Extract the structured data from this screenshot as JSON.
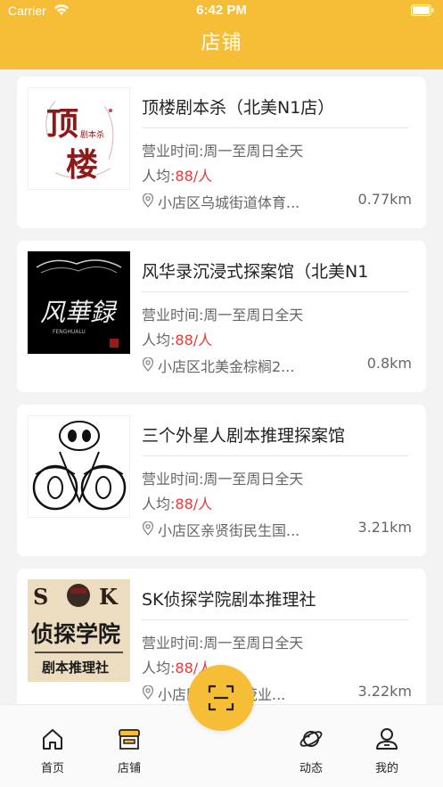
{
  "status_bar": {
    "carrier": "Carrier",
    "time": "6:42 PM"
  },
  "header": {
    "title": "店铺"
  },
  "stores": [
    {
      "name": "顶楼剧本杀（北美N1店）",
      "hours": "营业时间:周一至周日全天",
      "price_prefix": "人均:",
      "price": "88/人",
      "address": "小店区乌城街道体育...",
      "distance": "0.77km",
      "thumb_text": "顶楼"
    },
    {
      "name": "风华录沉浸式探案馆（北美N1",
      "hours": "营业时间:周一至周日全天",
      "price_prefix": "人均:",
      "price": "88/人",
      "address": "小店区北美金棕榈2...",
      "distance": "0.8km",
      "thumb_text": "风華録"
    },
    {
      "name": "三个外星人剧本推理探案馆",
      "hours": "营业时间:周一至周日全天",
      "price_prefix": "人均:",
      "price": "88/人",
      "address": "小店区亲贤街民生国...",
      "distance": "3.21km",
      "thumb_text": ""
    },
    {
      "name": "SK侦探学院剧本推理社",
      "hours": "营业时间:周一至周日全天",
      "price_prefix": "人均:",
      "price": "88/人",
      "address": "小店区亲贤街茂业...",
      "distance": "3.22km",
      "thumb_text": "侦探学院"
    }
  ],
  "tabbar": {
    "home": "首页",
    "store": "店铺",
    "feed": "动态",
    "mine": "我的"
  },
  "colors": {
    "accent": "#f6bd37",
    "price": "#e53a3a"
  },
  "icons": [
    "wifi-icon",
    "battery-icon",
    "location-pin-icon",
    "home-icon",
    "store-icon",
    "scan-icon",
    "planet-icon",
    "user-icon"
  ]
}
